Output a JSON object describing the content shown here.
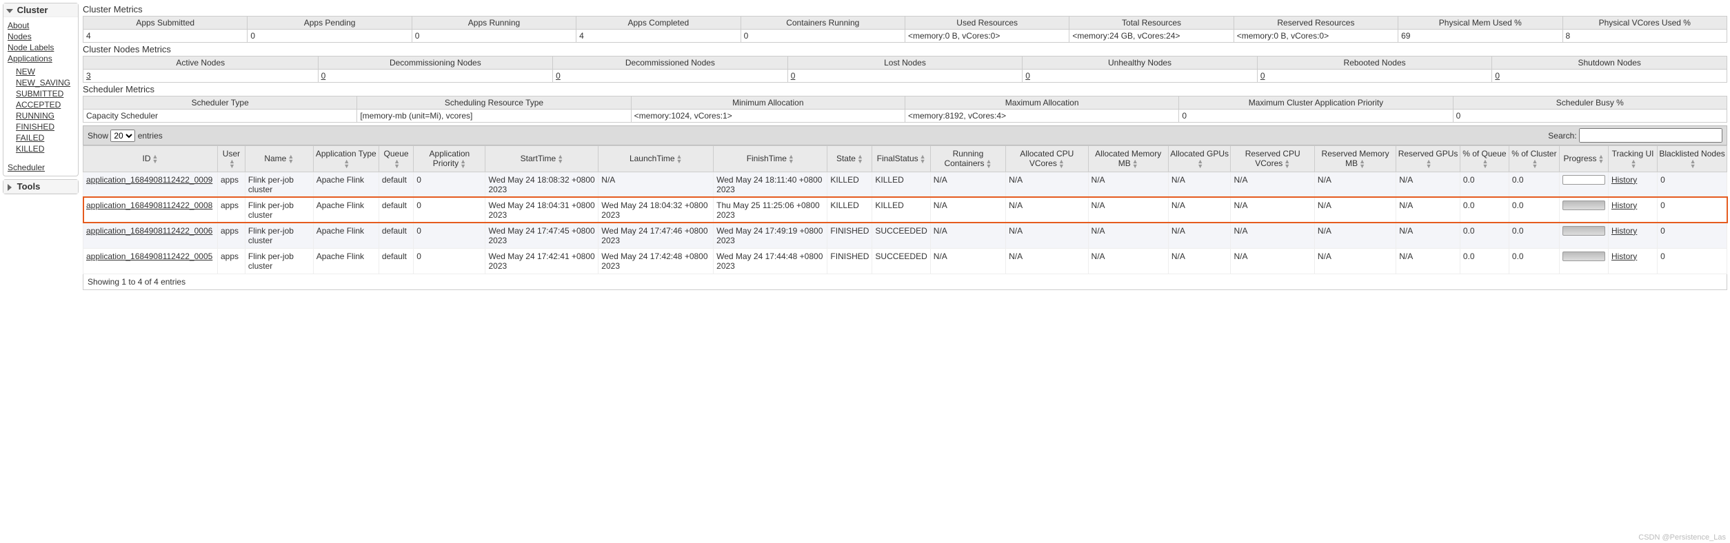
{
  "sidebar": {
    "cluster": {
      "title": "Cluster",
      "links": [
        "About",
        "Nodes",
        "Node Labels",
        "Applications"
      ],
      "appstates": [
        "NEW",
        "NEW_SAVING",
        "SUBMITTED",
        "ACCEPTED",
        "RUNNING",
        "FINISHED",
        "FAILED",
        "KILLED"
      ],
      "scheduler": "Scheduler"
    },
    "tools": {
      "title": "Tools"
    }
  },
  "sections": {
    "cluster_metrics": "Cluster Metrics",
    "cluster_nodes": "Cluster Nodes Metrics",
    "scheduler_metrics": "Scheduler Metrics"
  },
  "cluster_metrics": {
    "headers": [
      "Apps Submitted",
      "Apps Pending",
      "Apps Running",
      "Apps Completed",
      "Containers Running",
      "Used Resources",
      "Total Resources",
      "Reserved Resources",
      "Physical Mem Used %",
      "Physical VCores Used %"
    ],
    "values": [
      "4",
      "0",
      "0",
      "4",
      "0",
      "<memory:0 B, vCores:0>",
      "<memory:24 GB, vCores:24>",
      "<memory:0 B, vCores:0>",
      "69",
      "8"
    ]
  },
  "nodes_metrics": {
    "headers": [
      "Active Nodes",
      "Decommissioning Nodes",
      "Decommissioned Nodes",
      "Lost Nodes",
      "Unhealthy Nodes",
      "Rebooted Nodes",
      "Shutdown Nodes"
    ],
    "values": [
      "3",
      "0",
      "0",
      "0",
      "0",
      "0",
      "0"
    ]
  },
  "scheduler_metrics": {
    "headers": [
      "Scheduler Type",
      "Scheduling Resource Type",
      "Minimum Allocation",
      "Maximum Allocation",
      "Maximum Cluster Application Priority",
      "Scheduler Busy %"
    ],
    "values": [
      "Capacity Scheduler",
      "[memory-mb (unit=Mi), vcores]",
      "<memory:1024, vCores:1>",
      "<memory:8192, vCores:4>",
      "0",
      "0"
    ]
  },
  "showbar": {
    "show": "Show",
    "entries": "entries",
    "page_size": "20",
    "search_label": "Search:",
    "search_value": ""
  },
  "apps": {
    "headers": [
      "ID",
      "User",
      "Name",
      "Application Type",
      "Queue",
      "Application Priority",
      "StartTime",
      "LaunchTime",
      "FinishTime",
      "State",
      "FinalStatus",
      "Running Containers",
      "Allocated CPU VCores",
      "Allocated Memory MB",
      "Allocated GPUs",
      "Reserved CPU VCores",
      "Reserved Memory MB",
      "Reserved GPUs",
      "% of Queue",
      "% of Cluster",
      "Progress",
      "Tracking UI",
      "Blacklisted Nodes"
    ],
    "rows": [
      {
        "id": "application_1684908112422_0009",
        "user": "apps",
        "name": "Flink per-job cluster",
        "type": "Apache Flink",
        "queue": "default",
        "priority": "0",
        "start": "Wed May 24 18:08:32 +0800 2023",
        "launch": "N/A",
        "finish": "Wed May 24 18:11:40 +0800 2023",
        "state": "KILLED",
        "final": "KILLED",
        "rc": "N/A",
        "acpu": "N/A",
        "amem": "N/A",
        "agpu": "N/A",
        "rcpu": "N/A",
        "rmem": "N/A",
        "rgpu": "N/A",
        "pq": "0.0",
        "pc": "0.0",
        "track": "History",
        "bl": "0",
        "prog_full": false
      },
      {
        "id": "application_1684908112422_0008",
        "user": "apps",
        "name": "Flink per-job cluster",
        "type": "Apache Flink",
        "queue": "default",
        "priority": "0",
        "start": "Wed May 24 18:04:31 +0800 2023",
        "launch": "Wed May 24 18:04:32 +0800 2023",
        "finish": "Thu May 25 11:25:06 +0800 2023",
        "state": "KILLED",
        "final": "KILLED",
        "rc": "N/A",
        "acpu": "N/A",
        "amem": "N/A",
        "agpu": "N/A",
        "rcpu": "N/A",
        "rmem": "N/A",
        "rgpu": "N/A",
        "pq": "0.0",
        "pc": "0.0",
        "track": "History",
        "bl": "0",
        "prog_full": true,
        "hl": true
      },
      {
        "id": "application_1684908112422_0006",
        "user": "apps",
        "name": "Flink per-job cluster",
        "type": "Apache Flink",
        "queue": "default",
        "priority": "0",
        "start": "Wed May 24 17:47:45 +0800 2023",
        "launch": "Wed May 24 17:47:46 +0800 2023",
        "finish": "Wed May 24 17:49:19 +0800 2023",
        "state": "FINISHED",
        "final": "SUCCEEDED",
        "rc": "N/A",
        "acpu": "N/A",
        "amem": "N/A",
        "agpu": "N/A",
        "rcpu": "N/A",
        "rmem": "N/A",
        "rgpu": "N/A",
        "pq": "0.0",
        "pc": "0.0",
        "track": "History",
        "bl": "0",
        "prog_full": true
      },
      {
        "id": "application_1684908112422_0005",
        "user": "apps",
        "name": "Flink per-job cluster",
        "type": "Apache Flink",
        "queue": "default",
        "priority": "0",
        "start": "Wed May 24 17:42:41 +0800 2023",
        "launch": "Wed May 24 17:42:48 +0800 2023",
        "finish": "Wed May 24 17:44:48 +0800 2023",
        "state": "FINISHED",
        "final": "SUCCEEDED",
        "rc": "N/A",
        "acpu": "N/A",
        "amem": "N/A",
        "agpu": "N/A",
        "rcpu": "N/A",
        "rmem": "N/A",
        "rgpu": "N/A",
        "pq": "0.0",
        "pc": "0.0",
        "track": "History",
        "bl": "0",
        "prog_full": true
      }
    ]
  },
  "footer": {
    "info": "Showing 1 to 4 of 4 entries"
  },
  "watermark": "CSDN @Persistence_Las"
}
